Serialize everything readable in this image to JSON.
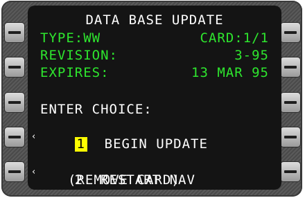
{
  "title": "DATA BASE UPDATE",
  "type_label": "TYPE:WW",
  "card_label": "CARD:1/1",
  "revision_label": "REVISION:",
  "revision_value": "3-95",
  "expires_label": "EXPIRES:",
  "expires_value": "13 MAR 95",
  "prompt": "ENTER CHOICE:",
  "option1_number": "1",
  "option1_label": "BEGIN UPDATE",
  "option2_number": "2",
  "option2_label": "RESTART NAV",
  "option2_sub": "(REMOVE CARD)",
  "caret_glyph": "‹",
  "colors": {
    "text": "#ffffff",
    "data": "#2ee62e",
    "highlight": "#ffff00",
    "screen": "#141414"
  }
}
